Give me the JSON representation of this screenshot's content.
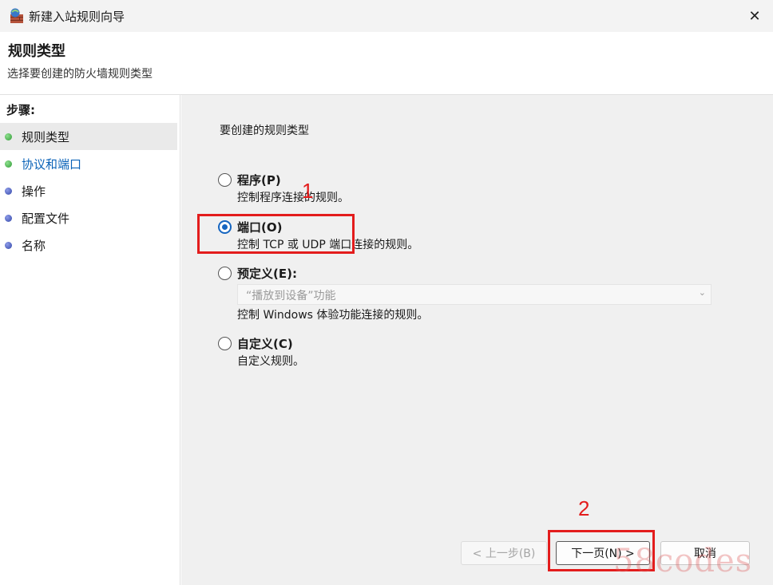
{
  "window": {
    "title": "新建入站规则向导",
    "close_glyph": "✕"
  },
  "header": {
    "title": "规则类型",
    "subtitle": "选择要创建的防火墙规则类型"
  },
  "sidebar": {
    "steps_label": "步骤:",
    "steps": [
      {
        "label": "规则类型",
        "dot": "green",
        "selected": true
      },
      {
        "label": "协议和端口",
        "dot": "green",
        "selected": false
      },
      {
        "label": "操作",
        "dot": "blue",
        "selected": false
      },
      {
        "label": "配置文件",
        "dot": "blue",
        "selected": false
      },
      {
        "label": "名称",
        "dot": "blue",
        "selected": false
      }
    ]
  },
  "main": {
    "prompt": "要创建的规则类型",
    "options": [
      {
        "title": "程序(P)",
        "desc": "控制程序连接的规则。",
        "checked": false
      },
      {
        "title": "端口(O)",
        "desc": "控制 TCP 或 UDP 端口连接的规则。",
        "checked": true
      },
      {
        "title": "预定义(E):",
        "desc": "控制 Windows 体验功能连接的规则。",
        "checked": false
      },
      {
        "title": "自定义(C)",
        "desc": "自定义规则。",
        "checked": false
      }
    ],
    "predefined_dropdown": {
      "value": "“播放到设备”功能",
      "chevron": "⌄"
    }
  },
  "buttons": {
    "back": "< 上一步(B)",
    "next": "下一页(N) >",
    "cancel": "取消"
  },
  "annotations": {
    "one": "1",
    "two": "2",
    "color": "#e31c1c"
  },
  "watermark": "58codes",
  "colors": {
    "accent": "#1565c0",
    "link": "#0b63b8",
    "annotation": "#e31c1c"
  }
}
